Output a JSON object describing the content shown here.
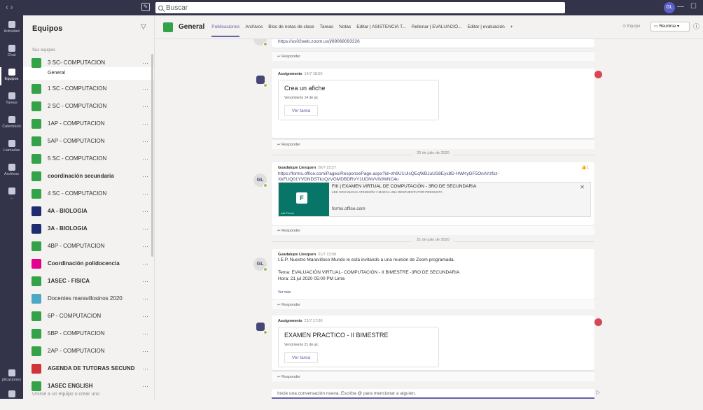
{
  "topbar": {
    "nav": "‹ ›",
    "search_placeholder": "Buscar",
    "user_initials": "GL",
    "minimize": "—",
    "maximize": "☐"
  },
  "rail": [
    {
      "label": "Actividad",
      "icon": "bell-icon"
    },
    {
      "label": "Chat",
      "icon": "chat-icon"
    },
    {
      "label": "Equipos",
      "icon": "teams-icon"
    },
    {
      "label": "Tareas",
      "icon": "assignments-icon"
    },
    {
      "label": "Calendario",
      "icon": "calendar-icon"
    },
    {
      "label": "Llamadas",
      "icon": "phone-icon"
    },
    {
      "label": "Archivos",
      "icon": "files-icon"
    },
    {
      "label": "...",
      "icon": "more-icon"
    },
    {
      "label": "plicaciones",
      "icon": "apps-icon"
    },
    {
      "label": "",
      "icon": "help-icon"
    }
  ],
  "teams_panel": {
    "title": "Equipos",
    "section_label": "Sus equipos",
    "selected_channel": "General",
    "join_label": "Unirse a un equipo o crear uno",
    "teams": [
      {
        "name": "3 SC- COMPUTACION",
        "color": "#33a248",
        "bold": false
      },
      {
        "name": "1 SC - COMPUTACION",
        "color": "#33a248",
        "bold": false
      },
      {
        "name": "2 SC - COMPUTACION",
        "color": "#33a248",
        "bold": false
      },
      {
        "name": "1AP - COMPUTACION",
        "color": "#33a248",
        "bold": false
      },
      {
        "name": "5AP - COMPUTACION",
        "color": "#33a248",
        "bold": false
      },
      {
        "name": "5 SC - COMPUTACION",
        "color": "#33a248",
        "bold": false
      },
      {
        "name": "coordinación secundaria",
        "color": "#33a248",
        "bold": true
      },
      {
        "name": "4 SC - COMPUTACION",
        "color": "#33a248",
        "bold": false
      },
      {
        "name": "4A - BIOLOGIA",
        "color": "#1e2b6e",
        "bold": true
      },
      {
        "name": "3A - BIOLOGIA",
        "color": "#1e2b6e",
        "bold": true
      },
      {
        "name": "4BP - COMPUTACION",
        "color": "#33a248",
        "bold": false
      },
      {
        "name": "Coordinación polidocencia",
        "color": "#e3008c",
        "bold": true
      },
      {
        "name": "1ASEC - FISICA",
        "color": "#33a248",
        "bold": true
      },
      {
        "name": "Docentes maravillosinos 2020",
        "color": "#4fa7c6",
        "bold": false
      },
      {
        "name": "6P - COMPUTACION",
        "color": "#33a248",
        "bold": false
      },
      {
        "name": "5BP - COMPUTACION",
        "color": "#33a248",
        "bold": false
      },
      {
        "name": "2AP - COMPUTACION",
        "color": "#33a248",
        "bold": false
      },
      {
        "name": "AGENDA DE TUTORAS SECUNDARIA",
        "color": "#d13438",
        "bold": true
      },
      {
        "name": "1ASEC ENGLISH",
        "color": "#33a248",
        "bold": true
      }
    ]
  },
  "channel_header": {
    "title": "General",
    "tabs": [
      "Publicaciones",
      "Archivos",
      "Bloc de notas de clase",
      "Tareas",
      "Notas",
      "Editar | ASISTENCIA T...",
      "Rellenar | EVALUACIÓ...",
      "Editar | evaluación",
      "+"
    ],
    "equipo_label": "Equipo",
    "reunirse_label": "Reunirse"
  },
  "feed": {
    "top_link": "https://us02web.zoom.us/j/89068093226",
    "reply_label": "Responder",
    "assignment1": {
      "author": "Assignments",
      "time": "14/7 18:50",
      "title": "Crea un afiche",
      "due": "Vencimiento 14 de jul.",
      "button": "Ver tarea"
    },
    "date1": "20 de julio de 2020",
    "post1": {
      "initials": "GL",
      "author": "Guadalupe Llesquen",
      "time": "20/7 23:27",
      "url_line1": "https://forms.office.com/Pages/ResponsePage.aspx?id=zh9U1UlsQEqWBJuUS8Eyx8D-HWKyGF5OnAYzfsz-",
      "url_line2": "XkFUQ01YVDNDSTkzQzVGMDBDRVY1UDNVV0dWNC4u",
      "likes": "1",
      "form_title": "FIII | EXAMEN VIRTUAL DE COMPUTACIÓN - 3RO DE SECUNDARIA",
      "form_subtitle": "LEE CON MUCHA ATENCIÓN Y MARCA UNA RESPUESTA POR PREGUNTA",
      "form_domain": "forms.office.com",
      "form_app": "soft Forms"
    },
    "date2": "21 de julio de 2020",
    "post2": {
      "initials": "GL",
      "author": "Guadalupe Llesquen",
      "time": "21/7 13:58",
      "line1": "I.E.P. Nuestro Maravilloso Mundo le está invitando a una reunión de Zoom programada.",
      "line2": "Tema: EVALUACIÓN VIRTUAL- COMPUTACIÓN -  II BIMESTRE -3RO DE SECUNDARIA",
      "line3": "Hora: 21 jul 2020 05:00 PM Lima",
      "see_more": "Ver más"
    },
    "assignment2": {
      "author": "Assignments",
      "time": "21/7 17:00",
      "title": "EXAMEN PRACTICO - II BIMESTRE",
      "due": "Vencimiento 21 de jul.",
      "button": "Ver tarea"
    },
    "compose_placeholder": "Inicie una conversación nueva. Escriba @ para mencionar a alguien."
  }
}
